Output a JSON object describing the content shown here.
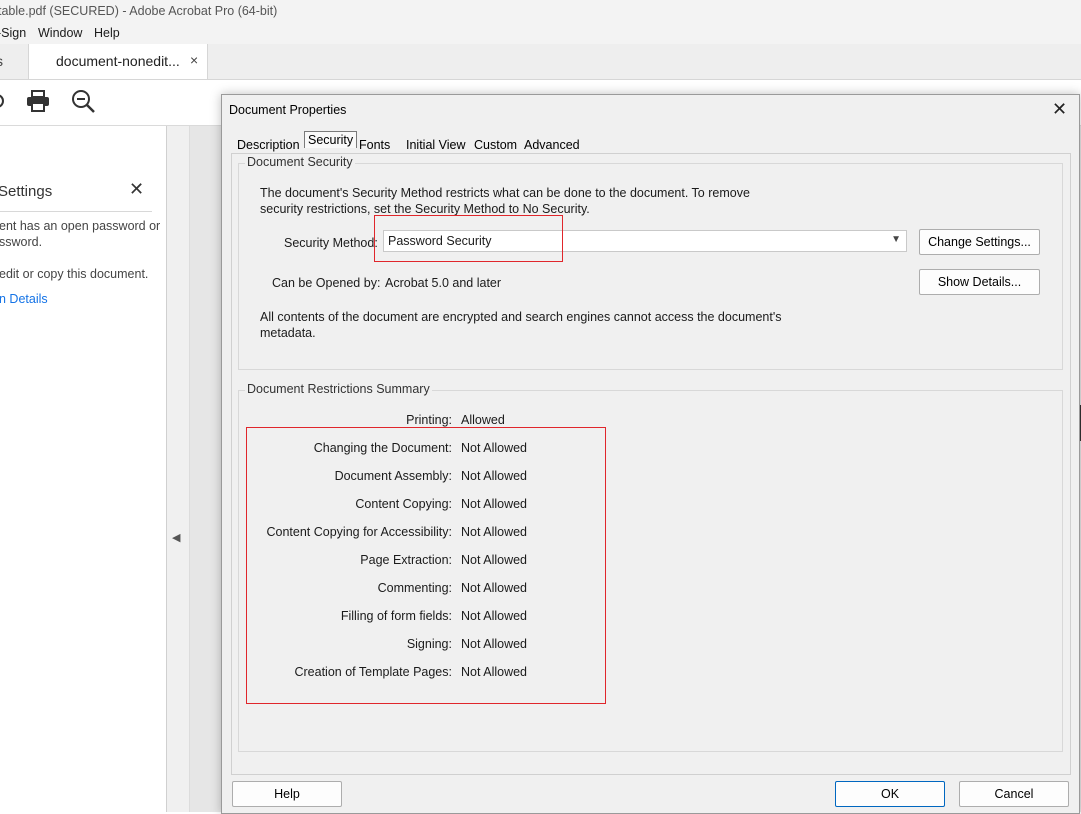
{
  "window": {
    "title": "table.pdf (SECURED) - Adobe Acrobat Pro (64-bit)",
    "menu": [
      "-Sign",
      "Window",
      "Help"
    ],
    "tab_label": "document-nonedit...",
    "tab_close": "×",
    "tab_edge_glyph": "s"
  },
  "panel": {
    "title": "Settings",
    "close": "✕",
    "line1": "ent has an open password or",
    "line2": "ssword.",
    "line3": "edit or copy this document.",
    "link": "n Details"
  },
  "dialog": {
    "title": "Document Properties",
    "close": "✕",
    "tabs": [
      "Description",
      "Security",
      "Fonts",
      "Initial View",
      "Custom",
      "Advanced"
    ],
    "active_tab": "Security",
    "document_security": {
      "title": "Document Security",
      "intro_line1": "The document's Security Method restricts what can be done to the document. To remove",
      "intro_line2": "security restrictions, set the Security Method to No Security.",
      "method_label": "Security Method:",
      "method_value": "Password Security",
      "change_settings": "Change Settings...",
      "opened_by_label": "Can be Opened by:",
      "opened_by_value": "Acrobat 5.0 and later",
      "show_details": "Show Details...",
      "note_line1": "All contents of the document are encrypted and search engines cannot access the document's",
      "note_line2": "metadata."
    },
    "restrictions": {
      "title": "Document Restrictions Summary",
      "items": [
        {
          "label": "Printing:",
          "value": "Allowed"
        },
        {
          "label": "Changing the Document:",
          "value": "Not Allowed"
        },
        {
          "label": "Document Assembly:",
          "value": "Not Allowed"
        },
        {
          "label": "Content Copying:",
          "value": "Not Allowed"
        },
        {
          "label": "Content Copying for Accessibility:",
          "value": "Not Allowed"
        },
        {
          "label": "Page Extraction:",
          "value": "Not Allowed"
        },
        {
          "label": "Commenting:",
          "value": "Not Allowed"
        },
        {
          "label": "Filling of form fields:",
          "value": "Not Allowed"
        },
        {
          "label": "Signing:",
          "value": "Not Allowed"
        },
        {
          "label": "Creation of Template Pages:",
          "value": "Not Allowed"
        }
      ]
    },
    "buttons": {
      "help": "Help",
      "ok": "OK",
      "cancel": "Cancel"
    }
  },
  "colors": {
    "highlight": "#e0262b",
    "link": "#1473e6",
    "ok_border": "#0067c0"
  }
}
